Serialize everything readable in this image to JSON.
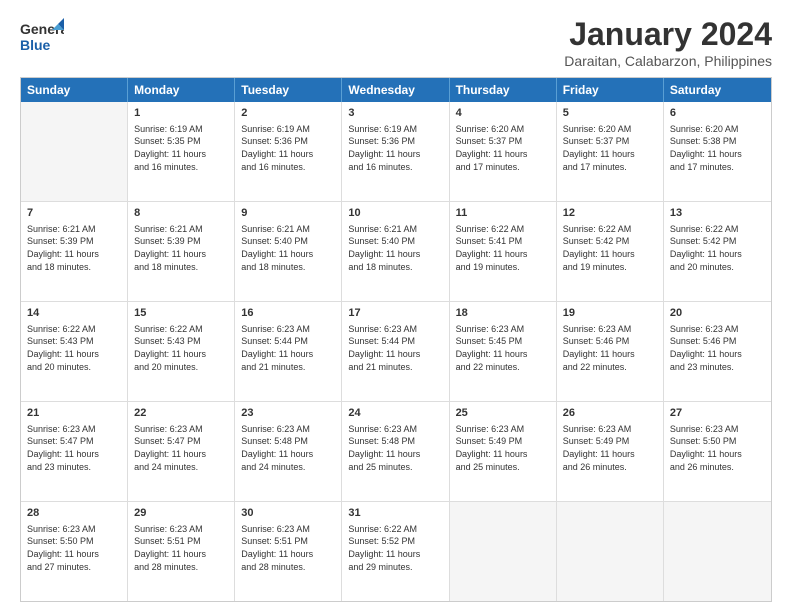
{
  "header": {
    "logo_line1": "General",
    "logo_line2": "Blue",
    "title": "January 2024",
    "subtitle": "Daraitan, Calabarzon, Philippines"
  },
  "days": [
    "Sunday",
    "Monday",
    "Tuesday",
    "Wednesday",
    "Thursday",
    "Friday",
    "Saturday"
  ],
  "weeks": [
    [
      {
        "day": "",
        "info": ""
      },
      {
        "day": "1",
        "info": "Sunrise: 6:19 AM\nSunset: 5:35 PM\nDaylight: 11 hours\nand 16 minutes."
      },
      {
        "day": "2",
        "info": "Sunrise: 6:19 AM\nSunset: 5:36 PM\nDaylight: 11 hours\nand 16 minutes."
      },
      {
        "day": "3",
        "info": "Sunrise: 6:19 AM\nSunset: 5:36 PM\nDaylight: 11 hours\nand 16 minutes."
      },
      {
        "day": "4",
        "info": "Sunrise: 6:20 AM\nSunset: 5:37 PM\nDaylight: 11 hours\nand 17 minutes."
      },
      {
        "day": "5",
        "info": "Sunrise: 6:20 AM\nSunset: 5:37 PM\nDaylight: 11 hours\nand 17 minutes."
      },
      {
        "day": "6",
        "info": "Sunrise: 6:20 AM\nSunset: 5:38 PM\nDaylight: 11 hours\nand 17 minutes."
      }
    ],
    [
      {
        "day": "7",
        "info": "Sunrise: 6:21 AM\nSunset: 5:39 PM\nDaylight: 11 hours\nand 18 minutes."
      },
      {
        "day": "8",
        "info": "Sunrise: 6:21 AM\nSunset: 5:39 PM\nDaylight: 11 hours\nand 18 minutes."
      },
      {
        "day": "9",
        "info": "Sunrise: 6:21 AM\nSunset: 5:40 PM\nDaylight: 11 hours\nand 18 minutes."
      },
      {
        "day": "10",
        "info": "Sunrise: 6:21 AM\nSunset: 5:40 PM\nDaylight: 11 hours\nand 18 minutes."
      },
      {
        "day": "11",
        "info": "Sunrise: 6:22 AM\nSunset: 5:41 PM\nDaylight: 11 hours\nand 19 minutes."
      },
      {
        "day": "12",
        "info": "Sunrise: 6:22 AM\nSunset: 5:42 PM\nDaylight: 11 hours\nand 19 minutes."
      },
      {
        "day": "13",
        "info": "Sunrise: 6:22 AM\nSunset: 5:42 PM\nDaylight: 11 hours\nand 20 minutes."
      }
    ],
    [
      {
        "day": "14",
        "info": "Sunrise: 6:22 AM\nSunset: 5:43 PM\nDaylight: 11 hours\nand 20 minutes."
      },
      {
        "day": "15",
        "info": "Sunrise: 6:22 AM\nSunset: 5:43 PM\nDaylight: 11 hours\nand 20 minutes."
      },
      {
        "day": "16",
        "info": "Sunrise: 6:23 AM\nSunset: 5:44 PM\nDaylight: 11 hours\nand 21 minutes."
      },
      {
        "day": "17",
        "info": "Sunrise: 6:23 AM\nSunset: 5:44 PM\nDaylight: 11 hours\nand 21 minutes."
      },
      {
        "day": "18",
        "info": "Sunrise: 6:23 AM\nSunset: 5:45 PM\nDaylight: 11 hours\nand 22 minutes."
      },
      {
        "day": "19",
        "info": "Sunrise: 6:23 AM\nSunset: 5:46 PM\nDaylight: 11 hours\nand 22 minutes."
      },
      {
        "day": "20",
        "info": "Sunrise: 6:23 AM\nSunset: 5:46 PM\nDaylight: 11 hours\nand 23 minutes."
      }
    ],
    [
      {
        "day": "21",
        "info": "Sunrise: 6:23 AM\nSunset: 5:47 PM\nDaylight: 11 hours\nand 23 minutes."
      },
      {
        "day": "22",
        "info": "Sunrise: 6:23 AM\nSunset: 5:47 PM\nDaylight: 11 hours\nand 24 minutes."
      },
      {
        "day": "23",
        "info": "Sunrise: 6:23 AM\nSunset: 5:48 PM\nDaylight: 11 hours\nand 24 minutes."
      },
      {
        "day": "24",
        "info": "Sunrise: 6:23 AM\nSunset: 5:48 PM\nDaylight: 11 hours\nand 25 minutes."
      },
      {
        "day": "25",
        "info": "Sunrise: 6:23 AM\nSunset: 5:49 PM\nDaylight: 11 hours\nand 25 minutes."
      },
      {
        "day": "26",
        "info": "Sunrise: 6:23 AM\nSunset: 5:49 PM\nDaylight: 11 hours\nand 26 minutes."
      },
      {
        "day": "27",
        "info": "Sunrise: 6:23 AM\nSunset: 5:50 PM\nDaylight: 11 hours\nand 26 minutes."
      }
    ],
    [
      {
        "day": "28",
        "info": "Sunrise: 6:23 AM\nSunset: 5:50 PM\nDaylight: 11 hours\nand 27 minutes."
      },
      {
        "day": "29",
        "info": "Sunrise: 6:23 AM\nSunset: 5:51 PM\nDaylight: 11 hours\nand 28 minutes."
      },
      {
        "day": "30",
        "info": "Sunrise: 6:23 AM\nSunset: 5:51 PM\nDaylight: 11 hours\nand 28 minutes."
      },
      {
        "day": "31",
        "info": "Sunrise: 6:22 AM\nSunset: 5:52 PM\nDaylight: 11 hours\nand 29 minutes."
      },
      {
        "day": "",
        "info": ""
      },
      {
        "day": "",
        "info": ""
      },
      {
        "day": "",
        "info": ""
      }
    ]
  ]
}
